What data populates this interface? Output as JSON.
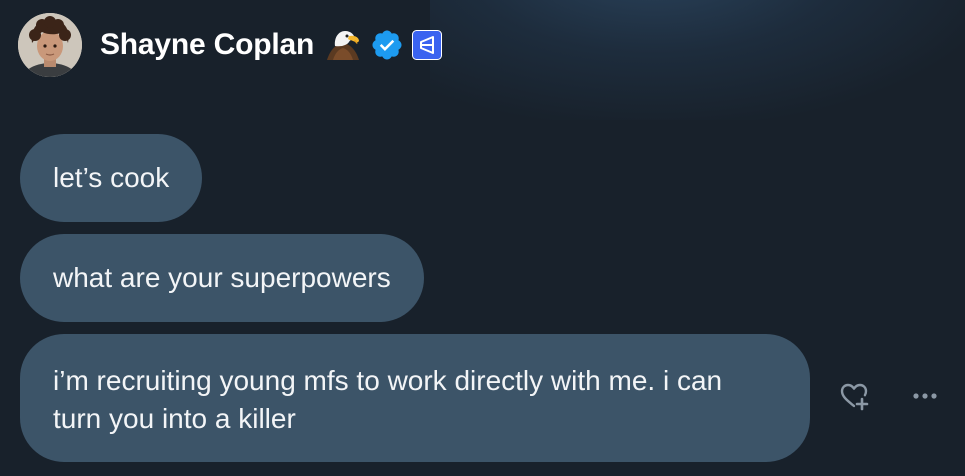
{
  "header": {
    "name": "Shayne Coplan",
    "icons": [
      "avatar",
      "eagle-emoji-icon",
      "verified-badge-icon",
      "affiliate-badge-icon"
    ]
  },
  "messages": [
    {
      "text": "let’s cook"
    },
    {
      "text": "what are your superpowers"
    },
    {
      "text": "i’m recruiting young mfs to work directly with me. i can turn you into a killer"
    }
  ],
  "actions": {
    "react_icon": "heart-plus-icon",
    "more_icon": "more-horizontal-icon"
  },
  "colors": {
    "background": "#18212b",
    "bubble": "#3c5468",
    "verified": "#1d9bf0",
    "affiliate": "#3a63f0"
  }
}
